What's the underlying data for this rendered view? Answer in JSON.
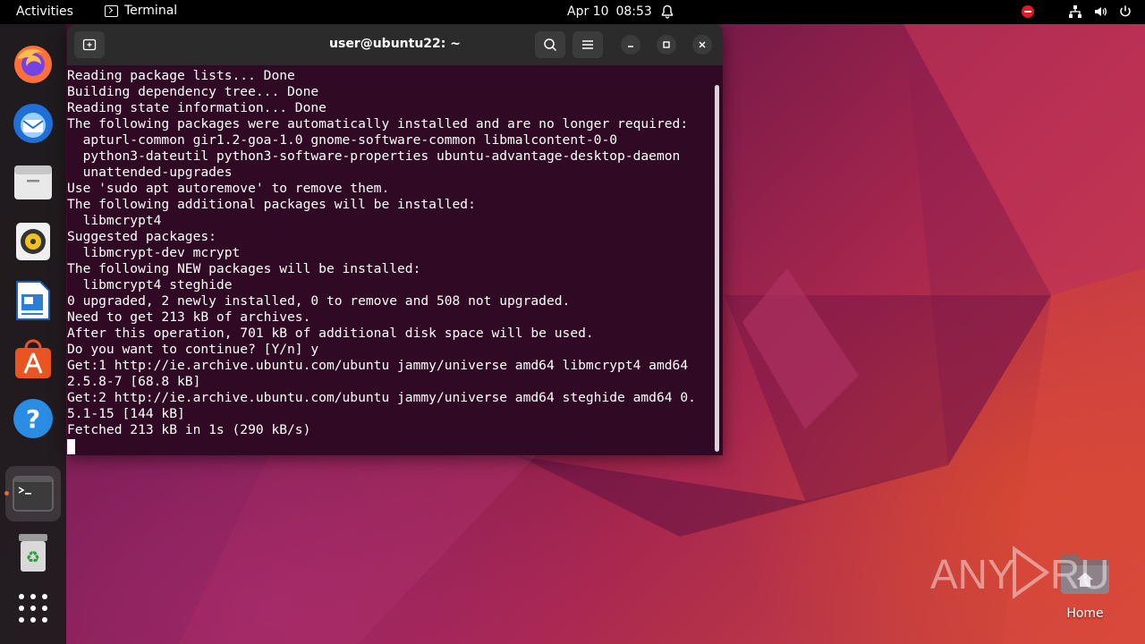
{
  "topbar": {
    "activities": "Activities",
    "app_name": "Terminal",
    "date": "Apr 10",
    "time": "08:53"
  },
  "dock": {
    "items": [
      {
        "name": "Firefox",
        "icon": "firefox-icon"
      },
      {
        "name": "Thunderbird",
        "icon": "thunderbird-icon"
      },
      {
        "name": "Files",
        "icon": "files-icon"
      },
      {
        "name": "Rhythmbox",
        "icon": "rhythmbox-icon"
      },
      {
        "name": "LibreOffice Writer",
        "icon": "writer-icon"
      },
      {
        "name": "Ubuntu Software",
        "icon": "software-icon"
      },
      {
        "name": "Help",
        "icon": "help-icon"
      },
      {
        "name": "Terminal",
        "icon": "terminal-icon",
        "active": true
      },
      {
        "name": "Trash",
        "icon": "trash-icon"
      },
      {
        "name": "Show Applications",
        "icon": "app-grid-icon"
      }
    ]
  },
  "terminal": {
    "title": "user@ubuntu22: ~",
    "lines": [
      "Reading package lists... Done",
      "Building dependency tree... Done",
      "Reading state information... Done",
      "The following packages were automatically installed and are no longer required:",
      "  apturl-common gir1.2-goa-1.0 gnome-software-common libmalcontent-0-0",
      "  python3-dateutil python3-software-properties ubuntu-advantage-desktop-daemon",
      "  unattended-upgrades",
      "Use 'sudo apt autoremove' to remove them.",
      "The following additional packages will be installed:",
      "  libmcrypt4",
      "Suggested packages:",
      "  libmcrypt-dev mcrypt",
      "The following NEW packages will be installed:",
      "  libmcrypt4 steghide",
      "0 upgraded, 2 newly installed, 0 to remove and 508 not upgraded.",
      "Need to get 213 kB of archives.",
      "After this operation, 701 kB of additional disk space will be used.",
      "Do you want to continue? [Y/n] y",
      "Get:1 http://ie.archive.ubuntu.com/ubuntu jammy/universe amd64 libmcrypt4 amd64",
      "2.5.8-7 [68.8 kB]",
      "Get:2 http://ie.archive.ubuntu.com/ubuntu jammy/universe amd64 steghide amd64 0.",
      "5.1-15 [144 kB]",
      "Fetched 213 kB in 1s (290 kB/s)"
    ]
  },
  "desktop": {
    "home_label": "Home",
    "watermark": "ANY RUN"
  },
  "colors": {
    "terminal_bg": "#300a24",
    "accent": "#e95420",
    "titlebar": "#2b2b2b"
  }
}
